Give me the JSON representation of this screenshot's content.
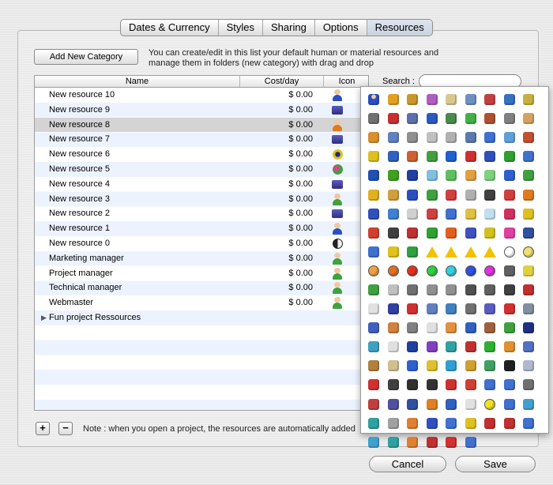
{
  "tabs": [
    "Dates & Currency",
    "Styles",
    "Sharing",
    "Options",
    "Resources"
  ],
  "selected_tab": "Resources",
  "add_category_label": "Add New Category",
  "description": "You can create/edit in this list your default human or material resources and manage them in folders (new category) with drag and drop",
  "search_label": "Search :",
  "search_value": "",
  "table": {
    "headers": {
      "name": "Name",
      "cost": "Cost/day",
      "icon": "Icon"
    },
    "rows": [
      {
        "name": "New resource 10",
        "cost": "$ 0.00",
        "icon": "person-blue-icon",
        "color": "#2a4fbf"
      },
      {
        "name": "New resource 9",
        "cost": "$ 0.00",
        "icon": "printer-icon",
        "color": "#5a5cc0"
      },
      {
        "name": "New resource 8",
        "cost": "$ 0.00",
        "icon": "person-orange-icon",
        "color": "#e07a1e"
      },
      {
        "name": "New resource 7",
        "cost": "$ 0.00",
        "icon": "printer-icon",
        "color": "#5a5cc0"
      },
      {
        "name": "New resource 6",
        "cost": "$ 0.00",
        "icon": "sun-gear-icon",
        "color": "#e0c21e"
      },
      {
        "name": "New resource 5",
        "cost": "$ 0.00",
        "icon": "flowers-icon",
        "color": "#d83a7a"
      },
      {
        "name": "New resource 4",
        "cost": "$ 0.00",
        "icon": "printer-icon",
        "color": "#5a5cc0"
      },
      {
        "name": "New resource 3",
        "cost": "$ 0.00",
        "icon": "person-green-icon",
        "color": "#3ea23e"
      },
      {
        "name": "New resource 2",
        "cost": "$ 0.00",
        "icon": "printer-icon",
        "color": "#5a5cc0"
      },
      {
        "name": "New resource 1",
        "cost": "$ 0.00",
        "icon": "person-blue-icon",
        "color": "#2a4fbf"
      },
      {
        "name": "New resource 0",
        "cost": "$ 0.00",
        "icon": "yin-yang-icon",
        "color": "#333333"
      },
      {
        "name": "Marketing manager",
        "cost": "$ 0.00",
        "icon": "person-green-icon",
        "color": "#3ea23e"
      },
      {
        "name": "Project manager",
        "cost": "$ 0.00",
        "icon": "person-green-icon",
        "color": "#3ea23e"
      },
      {
        "name": "Technical manager",
        "cost": "$ 0.00",
        "icon": "person-green-icon",
        "color": "#3ea23e"
      },
      {
        "name": "Webmaster",
        "cost": "$ 0.00",
        "icon": "person-green-icon",
        "color": "#3ea23e"
      }
    ],
    "folder": "Fun project Ressources"
  },
  "add_button": "+",
  "remove_button": "−",
  "note": "Note : when you open a project, the resources are automatically added",
  "cancel_label": "Cancel",
  "save_label": "Save",
  "icon_palette": [
    {
      "name": "person-blue-icon",
      "color": "#2a4fbf",
      "shape": "person"
    },
    {
      "name": "truck-icon",
      "color": "#e0a020"
    },
    {
      "name": "box-icon",
      "color": "#c9962a"
    },
    {
      "name": "car-icon",
      "color": "#b05cc0"
    },
    {
      "name": "hourglass-icon",
      "color": "#d8c890"
    },
    {
      "name": "building-icon",
      "color": "#6f8fc0"
    },
    {
      "name": "house-icon",
      "color": "#c04040"
    },
    {
      "name": "pen-icon",
      "color": "#3a70c0"
    },
    {
      "name": "pencils-icon",
      "color": "#c8b040"
    },
    {
      "name": "camera-icon",
      "color": "#707070"
    },
    {
      "name": "molecule-icon",
      "color": "#c83030"
    },
    {
      "name": "gear-icon",
      "color": "#5c6fb0"
    },
    {
      "name": "book-icon",
      "color": "#2a5ac0"
    },
    {
      "name": "books-icon",
      "color": "#4a8a4a"
    },
    {
      "name": "pencil-icon",
      "color": "#40b040"
    },
    {
      "name": "bag-icon",
      "color": "#b05030"
    },
    {
      "name": "tools-icon",
      "color": "#808080"
    },
    {
      "name": "palette-icon",
      "color": "#d8a060"
    },
    {
      "name": "people-icon",
      "color": "#d89030"
    },
    {
      "name": "robot-icon",
      "color": "#6080c0"
    },
    {
      "name": "gauge-icon",
      "color": "#909090"
    },
    {
      "name": "wrench-icon",
      "color": "#c0c0c0"
    },
    {
      "name": "window-icon",
      "color": "#b0b0b0"
    },
    {
      "name": "monitor-icon",
      "color": "#5a7ab0"
    },
    {
      "name": "globe-icon",
      "color": "#4070d0"
    },
    {
      "name": "clock-icon",
      "color": "#60a0d8"
    },
    {
      "name": "boxes-icon",
      "color": "#c05030"
    },
    {
      "name": "cylinder-yellow-icon",
      "color": "#e0c020"
    },
    {
      "name": "brush-icon",
      "color": "#3060c0"
    },
    {
      "name": "paintbrush-icon",
      "color": "#d06030"
    },
    {
      "name": "molecules-icon",
      "color": "#40a040"
    },
    {
      "name": "cube-blue-icon",
      "color": "#2060d0"
    },
    {
      "name": "cube-red-icon",
      "color": "#d03030"
    },
    {
      "name": "cube-blue2-icon",
      "color": "#3050c0"
    },
    {
      "name": "cubes-green-icon",
      "color": "#30a030"
    },
    {
      "name": "cubes-blue-icon",
      "color": "#4070d0"
    },
    {
      "name": "cube-blue3-icon",
      "color": "#2050b0"
    },
    {
      "name": "cube-green-icon",
      "color": "#40a020"
    },
    {
      "name": "cylinder-blue-icon",
      "color": "#2040a0"
    },
    {
      "name": "beaker-icon",
      "color": "#80c0e0"
    },
    {
      "name": "glass-green-icon",
      "color": "#60c060"
    },
    {
      "name": "glass-orange-icon",
      "color": "#e0a040"
    },
    {
      "name": "glass-green2-icon",
      "color": "#80d080"
    },
    {
      "name": "flag-blue-icon",
      "color": "#3060d0"
    },
    {
      "name": "flag-green-icon",
      "color": "#40a040"
    },
    {
      "name": "flag-yellow-icon",
      "color": "#e0b020"
    },
    {
      "name": "puzzle-icon",
      "color": "#d0a040"
    },
    {
      "name": "pawn-blue-icon",
      "color": "#2a50c0"
    },
    {
      "name": "pawn-green-icon",
      "color": "#40a040"
    },
    {
      "name": "pawn-red-icon",
      "color": "#d04040"
    },
    {
      "name": "pawn-gray-icon",
      "color": "#b0b0b0"
    },
    {
      "name": "agent-icon",
      "color": "#404040"
    },
    {
      "name": "person-red-icon",
      "color": "#d04040"
    },
    {
      "name": "person-orange-icon",
      "color": "#e07a1e"
    },
    {
      "name": "person-blue2-icon",
      "color": "#3050c0"
    },
    {
      "name": "capsule-icon",
      "color": "#4080d0"
    },
    {
      "name": "pill-icon",
      "color": "#d0d0d0"
    },
    {
      "name": "pill-red-icon",
      "color": "#d04040"
    },
    {
      "name": "pill-blue-icon",
      "color": "#4070d0"
    },
    {
      "name": "lamp-icon",
      "color": "#e0c040"
    },
    {
      "name": "flask-icon",
      "color": "#c0e0f0"
    },
    {
      "name": "berry-icon",
      "color": "#d03060"
    },
    {
      "name": "flask-yellow-icon",
      "color": "#e0c020"
    },
    {
      "name": "target-icon",
      "color": "#d04030"
    },
    {
      "name": "traffic-light-icon",
      "color": "#404040"
    },
    {
      "name": "traffic-light2-icon",
      "color": "#c03030"
    },
    {
      "name": "traffic-light3-icon",
      "color": "#30a030"
    },
    {
      "name": "fire-icon",
      "color": "#e06020"
    },
    {
      "name": "shape-blue-icon",
      "color": "#4050c0"
    },
    {
      "name": "sunburst-icon",
      "color": "#d0c020"
    },
    {
      "name": "flower-icon",
      "color": "#e040a0"
    },
    {
      "name": "laptop-icon",
      "color": "#3050a0"
    },
    {
      "name": "envelope-icon",
      "color": "#4070d0"
    },
    {
      "name": "sun-gear-icon",
      "color": "#e0c21e"
    },
    {
      "name": "recycle-icon",
      "color": "#30a040"
    },
    {
      "name": "warning-icon",
      "color": "#f2c200",
      "shape": "tri"
    },
    {
      "name": "radiation-icon",
      "color": "#f2c200",
      "shape": "tri"
    },
    {
      "name": "warning2-icon",
      "color": "#f2c200",
      "shape": "tri"
    },
    {
      "name": "caution-icon",
      "color": "#f2c200",
      "shape": "tri"
    },
    {
      "name": "circle-empty-icon",
      "color": "#ffffff",
      "shape": "circle"
    },
    {
      "name": "circle-yellow-icon",
      "color": "#f0e070",
      "shape": "circle"
    },
    {
      "name": "circle-orange-icon",
      "color": "#f0a040",
      "shape": "circle"
    },
    {
      "name": "circle-orange2-icon",
      "color": "#e07020",
      "shape": "circle"
    },
    {
      "name": "circle-red-icon",
      "color": "#e03020",
      "shape": "circle"
    },
    {
      "name": "circle-green-icon",
      "color": "#30d040",
      "shape": "circle"
    },
    {
      "name": "circle-cyan-icon",
      "color": "#30d0e0",
      "shape": "circle"
    },
    {
      "name": "circle-blue-icon",
      "color": "#3050e0",
      "shape": "circle"
    },
    {
      "name": "circle-magenta-icon",
      "color": "#e030e0",
      "shape": "circle"
    },
    {
      "name": "cog-icon",
      "color": "#606060"
    },
    {
      "name": "bulb-icon",
      "color": "#e0d040"
    },
    {
      "name": "money-icon",
      "color": "#40a040"
    },
    {
      "name": "cd-icon",
      "color": "#c0c0c0"
    },
    {
      "name": "drive-icon",
      "color": "#707070"
    },
    {
      "name": "lock-icon",
      "color": "#909090"
    },
    {
      "name": "shield-icon",
      "color": "#909090"
    },
    {
      "name": "tv-icon",
      "color": "#505050"
    },
    {
      "name": "radio-icon",
      "color": "#606060"
    },
    {
      "name": "phone-icon",
      "color": "#404040"
    },
    {
      "name": "cards-icon",
      "color": "#c03030"
    },
    {
      "name": "card-icon",
      "color": "#e0e0e0"
    },
    {
      "name": "chip-icon",
      "color": "#3040a0"
    },
    {
      "name": "alarm-clock-icon",
      "color": "#d03030"
    },
    {
      "name": "pallet-icon",
      "color": "#6080c0"
    },
    {
      "name": "badge-icon",
      "color": "#4080c0"
    },
    {
      "name": "projector-icon",
      "color": "#707070"
    },
    {
      "name": "print-icon",
      "color": "#5a5cc0"
    },
    {
      "name": "extinguisher-icon",
      "color": "#d03030"
    },
    {
      "name": "keyboard-icon",
      "color": "#8090a0"
    },
    {
      "name": "planet-icon",
      "color": "#4060c0"
    },
    {
      "name": "person-tan-icon",
      "color": "#d08040"
    },
    {
      "name": "person-gray-icon",
      "color": "#808080"
    },
    {
      "name": "person-white-icon",
      "color": "#e0e0e0"
    },
    {
      "name": "person-orange2-icon",
      "color": "#e09040"
    },
    {
      "name": "person-blue3-icon",
      "color": "#3060c0"
    },
    {
      "name": "person-brown-icon",
      "color": "#a06040"
    },
    {
      "name": "person-green2-icon",
      "color": "#40a040"
    },
    {
      "name": "person-navy-icon",
      "color": "#203080"
    },
    {
      "name": "person-cyan-icon",
      "color": "#40a0c0"
    },
    {
      "name": "person-doctor-icon",
      "color": "#e0e0e0"
    },
    {
      "name": "person-cop-icon",
      "color": "#2040a0"
    },
    {
      "name": "person-purple-icon",
      "color": "#8040c0"
    },
    {
      "name": "person-teal-icon",
      "color": "#30a0a0"
    },
    {
      "name": "person-red2-icon",
      "color": "#c03030"
    },
    {
      "name": "person-green3-icon",
      "color": "#30b030"
    },
    {
      "name": "people-group-icon",
      "color": "#e09030"
    },
    {
      "name": "people-pair-icon",
      "color": "#5070c0"
    },
    {
      "name": "hammer-icon",
      "color": "#b08040"
    },
    {
      "name": "hourglass2-icon",
      "color": "#d0c090"
    },
    {
      "name": "dice-icon",
      "color": "#3060d0"
    },
    {
      "name": "cheese-icon",
      "color": "#e0c030"
    },
    {
      "name": "pipe-icon",
      "color": "#30a0d0"
    },
    {
      "name": "key-icon",
      "color": "#d0a030"
    },
    {
      "name": "chain-icon",
      "color": "#40a060"
    },
    {
      "name": "vinyl-icon",
      "color": "#202020"
    },
    {
      "name": "disc-icon",
      "color": "#b0b8d0"
    },
    {
      "name": "first-aid-icon",
      "color": "#d03030"
    },
    {
      "name": "mouse-icon",
      "color": "#404040"
    },
    {
      "name": "tire-icon",
      "color": "#303030"
    },
    {
      "name": "yin-yang-icon",
      "color": "#333333"
    },
    {
      "name": "thermometer-icon",
      "color": "#d03030"
    },
    {
      "name": "pen-red-icon",
      "color": "#d04030"
    },
    {
      "name": "syringe-icon",
      "color": "#4070d0"
    },
    {
      "name": "joystick-icon",
      "color": "#4070d0"
    },
    {
      "name": "tape-icon",
      "color": "#707070"
    },
    {
      "name": "house2-icon",
      "color": "#c04040"
    },
    {
      "name": "chip2-icon",
      "color": "#5050a0"
    },
    {
      "name": "solar-panel-icon",
      "color": "#3050a0"
    },
    {
      "name": "sunflower-icon",
      "color": "#e08020"
    },
    {
      "name": "cube-blue4-icon",
      "color": "#3060c0"
    },
    {
      "name": "car-white-icon",
      "color": "#e0e0e0"
    },
    {
      "name": "bubble-icon",
      "color": "#f0e020",
      "shape": "circle"
    },
    {
      "name": "van-blue-icon",
      "color": "#4070d0"
    },
    {
      "name": "van-cyan-icon",
      "color": "#40a0d0"
    },
    {
      "name": "van-teal-icon",
      "color": "#30a0a0"
    },
    {
      "name": "van-gray-icon",
      "color": "#a0a0a0"
    },
    {
      "name": "van-orange-icon",
      "color": "#e08030"
    },
    {
      "name": "van-blue2-icon",
      "color": "#3050c0"
    },
    {
      "name": "truck-blue-icon",
      "color": "#4070d0"
    },
    {
      "name": "car-yellow-icon",
      "color": "#e0c020"
    },
    {
      "name": "truck-red-icon",
      "color": "#c03030"
    },
    {
      "name": "tractor-red-icon",
      "color": "#c03030"
    },
    {
      "name": "car-blue-icon",
      "color": "#4070d0"
    },
    {
      "name": "car-cyan-icon",
      "color": "#40a0d0"
    },
    {
      "name": "car-teal-icon",
      "color": "#30a0a0"
    },
    {
      "name": "car-orange-icon",
      "color": "#e08030"
    },
    {
      "name": "forklift-icon",
      "color": "#c03030"
    },
    {
      "name": "car-red-icon",
      "color": "#d03030"
    },
    {
      "name": "boat-icon",
      "color": "#4070d0"
    }
  ]
}
